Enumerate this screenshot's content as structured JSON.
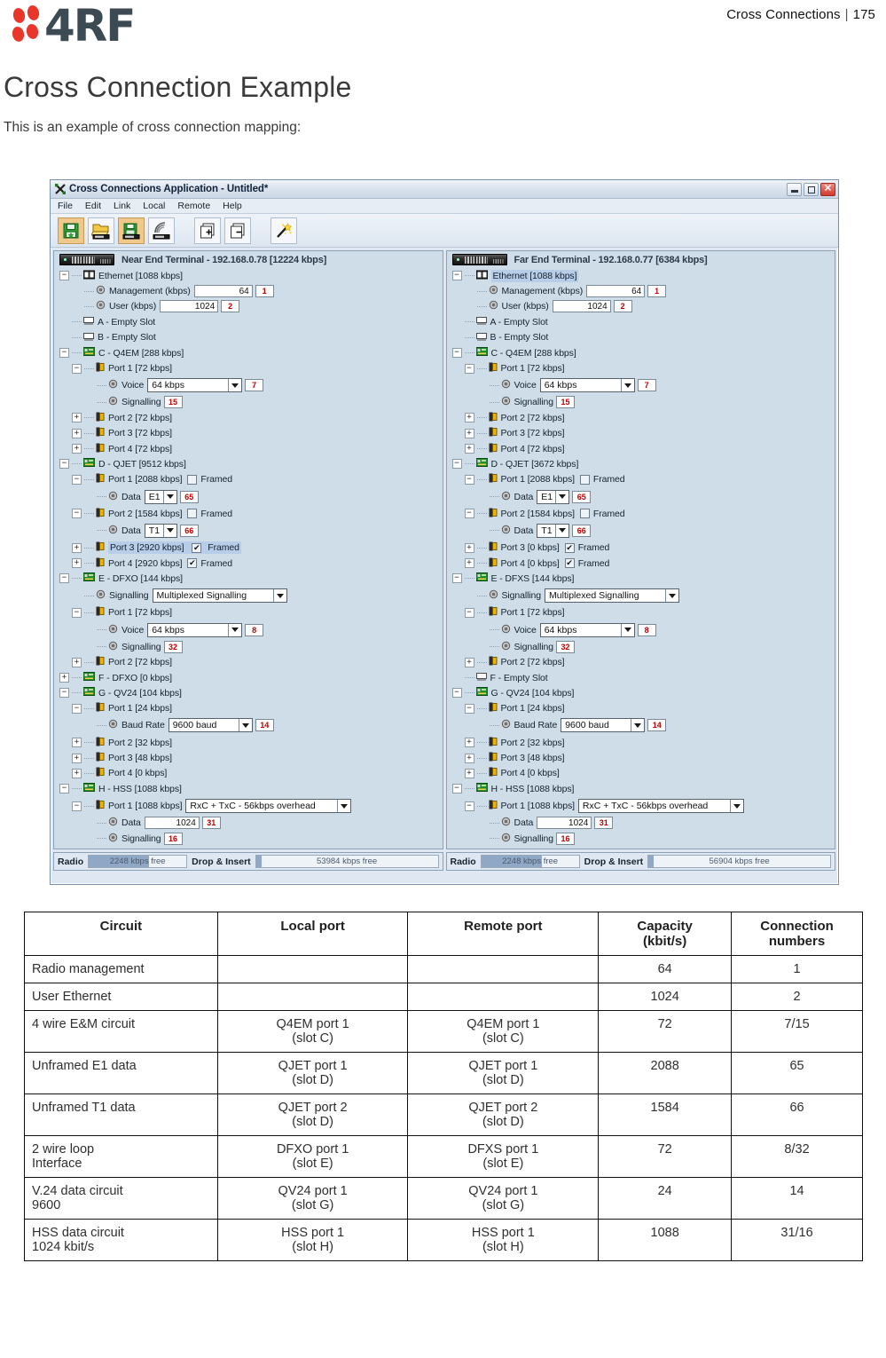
{
  "header": {
    "page_ref_title": "Cross Connections",
    "page_ref_sep": "|",
    "page_number": "175",
    "logo_text": "4RF"
  },
  "document": {
    "title": "Cross Connection Example",
    "intro": "This is an example of cross connection mapping:"
  },
  "app": {
    "title": "Cross Connections Application - Untitled*",
    "window_buttons": {
      "minimize": "_",
      "maximize": "□",
      "close": "✕"
    },
    "menu": [
      {
        "label": "File"
      },
      {
        "label": "Edit"
      },
      {
        "label": "Link"
      },
      {
        "label": "Local"
      },
      {
        "label": "Remote"
      },
      {
        "label": "Help"
      }
    ],
    "toolbar": [
      {
        "name": "save-icon",
        "tooltip": "Save"
      },
      {
        "name": "open-from-terminal-icon",
        "tooltip": "Open from terminal"
      },
      {
        "name": "save-to-terminal-icon",
        "tooltip": "Save to terminal"
      },
      {
        "name": "connect-terminal-icon",
        "tooltip": "Connect"
      },
      {
        "name": "expand-all-icon",
        "tooltip": "Expand all"
      },
      {
        "name": "collapse-all-icon",
        "tooltip": "Collapse all"
      },
      {
        "name": "wizard-icon",
        "tooltip": "Wizard"
      }
    ]
  },
  "near_end": {
    "terminal_label": "Near End Terminal - 192.168.0.78 [12224 kbps]",
    "ethernet": {
      "label": "Ethernet [1088 kbps]",
      "selected": false,
      "management": {
        "label": "Management (kbps)",
        "value": "64",
        "conn": "1"
      },
      "user": {
        "label": "User (kbps)",
        "value": "1024",
        "conn": "2"
      }
    },
    "slot_a": "A - Empty Slot",
    "slot_b": "B - Empty Slot",
    "slot_c": {
      "label": "C - Q4EM [288 kbps]",
      "port1": {
        "label": "Port 1 [72 kbps]",
        "voice": {
          "label": "Voice",
          "value": "64 kbps",
          "conn": "7"
        },
        "signalling": {
          "label": "Signalling",
          "conn": "15"
        }
      },
      "port2": "Port 2 [72 kbps]",
      "port3": "Port 3 [72 kbps]",
      "port4": "Port 4 [72 kbps]"
    },
    "slot_d": {
      "label": "D - QJET [9512 kbps]",
      "port1": {
        "label": "Port 1 [2088 kbps]",
        "framed_label": "Framed",
        "framed": false,
        "data": {
          "label": "Data",
          "value": "E1",
          "conn": "65"
        }
      },
      "port2": {
        "label": "Port 2 [1584 kbps]",
        "framed_label": "Framed",
        "framed": false,
        "data": {
          "label": "Data",
          "value": "T1",
          "conn": "66"
        }
      },
      "port3": {
        "label": "Port 3 [2920 kbps]",
        "framed_label": "Framed",
        "framed": true,
        "selected": true
      },
      "port4": {
        "label": "Port 4 [2920 kbps]",
        "framed_label": "Framed",
        "framed": true,
        "selected": false
      }
    },
    "slot_e": {
      "label": "E - DFXO [144 kbps]",
      "signalling": {
        "label": "Signalling",
        "value": "Multiplexed Signalling"
      },
      "port1": {
        "label": "Port 1 [72 kbps]",
        "voice": {
          "label": "Voice",
          "value": "64 kbps",
          "conn": "8"
        },
        "signalling": {
          "label": "Signalling",
          "conn": "32"
        }
      },
      "port2": "Port 2 [72 kbps]"
    },
    "slot_f": "F - DFXO [0 kbps]",
    "slot_g": {
      "label": "G - QV24 [104 kbps]",
      "port1": {
        "label": "Port 1 [24 kbps]",
        "baud": {
          "label": "Baud Rate",
          "value": "9600 baud",
          "conn": "14"
        }
      },
      "port2": "Port 2 [32 kbps]",
      "port3": "Port 3 [48 kbps]",
      "port4": "Port 4 [0 kbps]"
    },
    "slot_h": {
      "label": "H - HSS [1088 kbps]",
      "port1": {
        "label": "Port 1 [1088 kbps]",
        "mode": "RxC + TxC - 56kbps overhead",
        "data": {
          "label": "Data",
          "value": "1024",
          "conn": "31"
        },
        "signalling": {
          "label": "Signalling",
          "conn": "16"
        }
      }
    },
    "status": {
      "radio_label": "Radio",
      "radio_value": "2248 kbps free",
      "radio_fill_pct": 62,
      "di_label": "Drop & Insert",
      "di_value": "53984 kbps free",
      "di_fill_pct": 3
    }
  },
  "far_end": {
    "terminal_label": "Far End Terminal - 192.168.0.77 [6384 kbps]",
    "ethernet": {
      "label": "Ethernet [1088 kbps]",
      "selected": true,
      "management": {
        "label": "Management (kbps)",
        "value": "64",
        "conn": "1"
      },
      "user": {
        "label": "User (kbps)",
        "value": "1024",
        "conn": "2"
      }
    },
    "slot_a": "A - Empty Slot",
    "slot_b": "B - Empty Slot",
    "slot_c": {
      "label": "C - Q4EM [288 kbps]",
      "port1": {
        "label": "Port 1 [72 kbps]",
        "voice": {
          "label": "Voice",
          "value": "64 kbps",
          "conn": "7"
        },
        "signalling": {
          "label": "Signalling",
          "conn": "15"
        }
      },
      "port2": "Port 2 [72 kbps]",
      "port3": "Port 3 [72 kbps]",
      "port4": "Port 4 [72 kbps]"
    },
    "slot_d": {
      "label": "D - QJET [3672 kbps]",
      "port1": {
        "label": "Port 1 [2088 kbps]",
        "framed_label": "Framed",
        "framed": false,
        "data": {
          "label": "Data",
          "value": "E1",
          "conn": "65"
        }
      },
      "port2": {
        "label": "Port 2 [1584 kbps]",
        "framed_label": "Framed",
        "framed": false,
        "data": {
          "label": "Data",
          "value": "T1",
          "conn": "66"
        }
      },
      "port3": {
        "label": "Port 3 [0 kbps]",
        "framed_label": "Framed",
        "framed": true,
        "selected": false
      },
      "port4": {
        "label": "Port 4 [0 kbps]",
        "framed_label": "Framed",
        "framed": true,
        "selected": false
      }
    },
    "slot_e": {
      "label": "E - DFXS [144 kbps]",
      "signalling": {
        "label": "Signalling",
        "value": "Multiplexed Signalling"
      },
      "port1": {
        "label": "Port 1 [72 kbps]",
        "voice": {
          "label": "Voice",
          "value": "64 kbps",
          "conn": "8"
        },
        "signalling": {
          "label": "Signalling",
          "conn": "32"
        }
      },
      "port2": "Port 2 [72 kbps]"
    },
    "slot_f": "F - Empty Slot",
    "slot_g": {
      "label": "G - QV24 [104 kbps]",
      "port1": {
        "label": "Port 1 [24 kbps]",
        "baud": {
          "label": "Baud Rate",
          "value": "9600 baud",
          "conn": "14"
        }
      },
      "port2": "Port 2 [32 kbps]",
      "port3": "Port 3 [48 kbps]",
      "port4": "Port 4 [0 kbps]"
    },
    "slot_h": {
      "label": "H - HSS [1088 kbps]",
      "port1": {
        "label": "Port 1 [1088 kbps]",
        "mode": "RxC + TxC - 56kbps overhead",
        "data": {
          "label": "Data",
          "value": "1024",
          "conn": "31"
        },
        "signalling": {
          "label": "Signalling",
          "conn": "16"
        }
      }
    },
    "status": {
      "radio_label": "Radio",
      "radio_value": "2248 kbps free",
      "radio_fill_pct": 62,
      "di_label": "Drop & Insert",
      "di_value": "56904 kbps free",
      "di_fill_pct": 3
    }
  },
  "table": {
    "columns": [
      {
        "label": "Circuit"
      },
      {
        "label": "Local port"
      },
      {
        "label": "Remote port"
      },
      {
        "label": "Capacity (kbit/s)",
        "line1": "Capacity",
        "line2": "(kbit/s)"
      },
      {
        "label": "Connection numbers",
        "line1": "Connection",
        "line2": "numbers"
      }
    ],
    "rows": [
      {
        "circuit": "Radio management",
        "circuit2": "",
        "local": "",
        "local2": "",
        "remote": "",
        "remote2": "",
        "capacity": "64",
        "connection": "1"
      },
      {
        "circuit": "User Ethernet",
        "circuit2": "",
        "local": "",
        "local2": "",
        "remote": "",
        "remote2": "",
        "capacity": "1024",
        "connection": "2"
      },
      {
        "circuit": "4 wire E&M circuit",
        "circuit2": "",
        "local": "Q4EM port 1",
        "local2": "(slot C)",
        "remote": "Q4EM port 1",
        "remote2": "(slot C)",
        "capacity": "72",
        "connection": "7/15"
      },
      {
        "circuit": "Unframed E1 data",
        "circuit2": "",
        "local": "QJET port 1",
        "local2": "(slot D)",
        "remote": "QJET port 1",
        "remote2": "(slot D)",
        "capacity": "2088",
        "connection": "65"
      },
      {
        "circuit": "Unframed T1 data",
        "circuit2": "",
        "local": "QJET port 2",
        "local2": "(slot D)",
        "remote": "QJET port 2",
        "remote2": "(slot D)",
        "capacity": "1584",
        "connection": "66"
      },
      {
        "circuit": "2 wire loop",
        "circuit2": "Interface",
        "local": "DFXO port 1",
        "local2": "(slot E)",
        "remote": "DFXS port 1",
        "remote2": "(slot E)",
        "capacity": "72",
        "connection": "8/32"
      },
      {
        "circuit": "V.24 data circuit",
        "circuit2": "9600",
        "local": "QV24 port 1",
        "local2": "(slot G)",
        "remote": "QV24 port 1",
        "remote2": "(slot G)",
        "capacity": "24",
        "connection": "14"
      },
      {
        "circuit": "HSS data circuit",
        "circuit2": "1024 kbit/s",
        "local": "HSS port 1",
        "local2": "(slot H)",
        "remote": "HSS port 1",
        "remote2": "(slot H)",
        "capacity": "1088",
        "connection": "31/16"
      }
    ]
  },
  "colors": {
    "brand_red": "#e8362a",
    "brand_dark": "#3c4a54",
    "panel_bg": "#cfdde9",
    "selection": "#a9c4e4",
    "conn_number": "#c00000"
  }
}
